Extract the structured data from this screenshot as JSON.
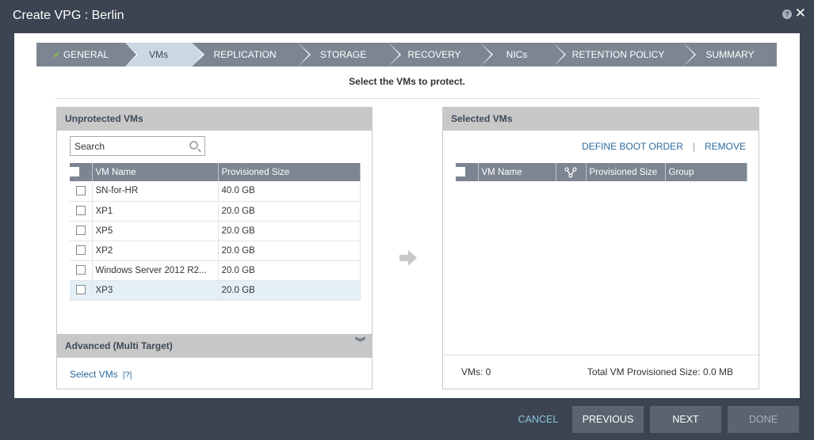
{
  "window": {
    "title": "Create VPG : Berlin",
    "help_icon": "question-circle-icon",
    "close_icon": "close-icon"
  },
  "wizard": {
    "steps": [
      {
        "label": "GENERAL",
        "state": "completed"
      },
      {
        "label": "VMs",
        "state": "active"
      },
      {
        "label": "REPLICATION",
        "state": "pending"
      },
      {
        "label": "STORAGE",
        "state": "pending"
      },
      {
        "label": "RECOVERY",
        "state": "pending"
      },
      {
        "label": "NICs",
        "state": "pending"
      },
      {
        "label": "RETENTION POLICY",
        "state": "pending"
      },
      {
        "label": "SUMMARY",
        "state": "pending"
      }
    ]
  },
  "page": {
    "subtitle": "Select the VMs to protect."
  },
  "unprotected": {
    "header": "Unprotected VMs",
    "search_placeholder": "Search",
    "columns": [
      "VM Name",
      "Provisioned Size"
    ],
    "rows": [
      {
        "name": "SN-for-HR",
        "size": "40.0 GB",
        "selected": false
      },
      {
        "name": "XP1",
        "size": "20.0 GB",
        "selected": false
      },
      {
        "name": "XP5",
        "size": "20.0 GB",
        "selected": false
      },
      {
        "name": "XP2",
        "size": "20.0 GB",
        "selected": false
      },
      {
        "name": "Windows Server 2012 R2...",
        "size": "20.0 GB",
        "selected": false
      },
      {
        "name": "XP3",
        "size": "20.0 GB",
        "selected": true
      }
    ],
    "advanced_header": "Advanced (Multi Target)",
    "select_vms_link": "Select VMs",
    "help_link": "|?|"
  },
  "selected": {
    "header": "Selected VMs",
    "define_boot_order": "DEFINE BOOT ORDER",
    "separator": "|",
    "remove": "REMOVE",
    "columns": [
      "VM Name",
      "Provisioned Size",
      "Group"
    ],
    "vms_count": "VMs: 0",
    "total_size": "Total VM Provisioned Size: 0.0 MB"
  },
  "footer": {
    "cancel": "CANCEL",
    "previous": "PREVIOUS",
    "next": "NEXT",
    "done": "DONE"
  },
  "colors": {
    "accent_link": "#2b6a9e",
    "header_bar": "#7c8591",
    "active_step": "#c9d8e3",
    "check": "#8bc34a"
  }
}
